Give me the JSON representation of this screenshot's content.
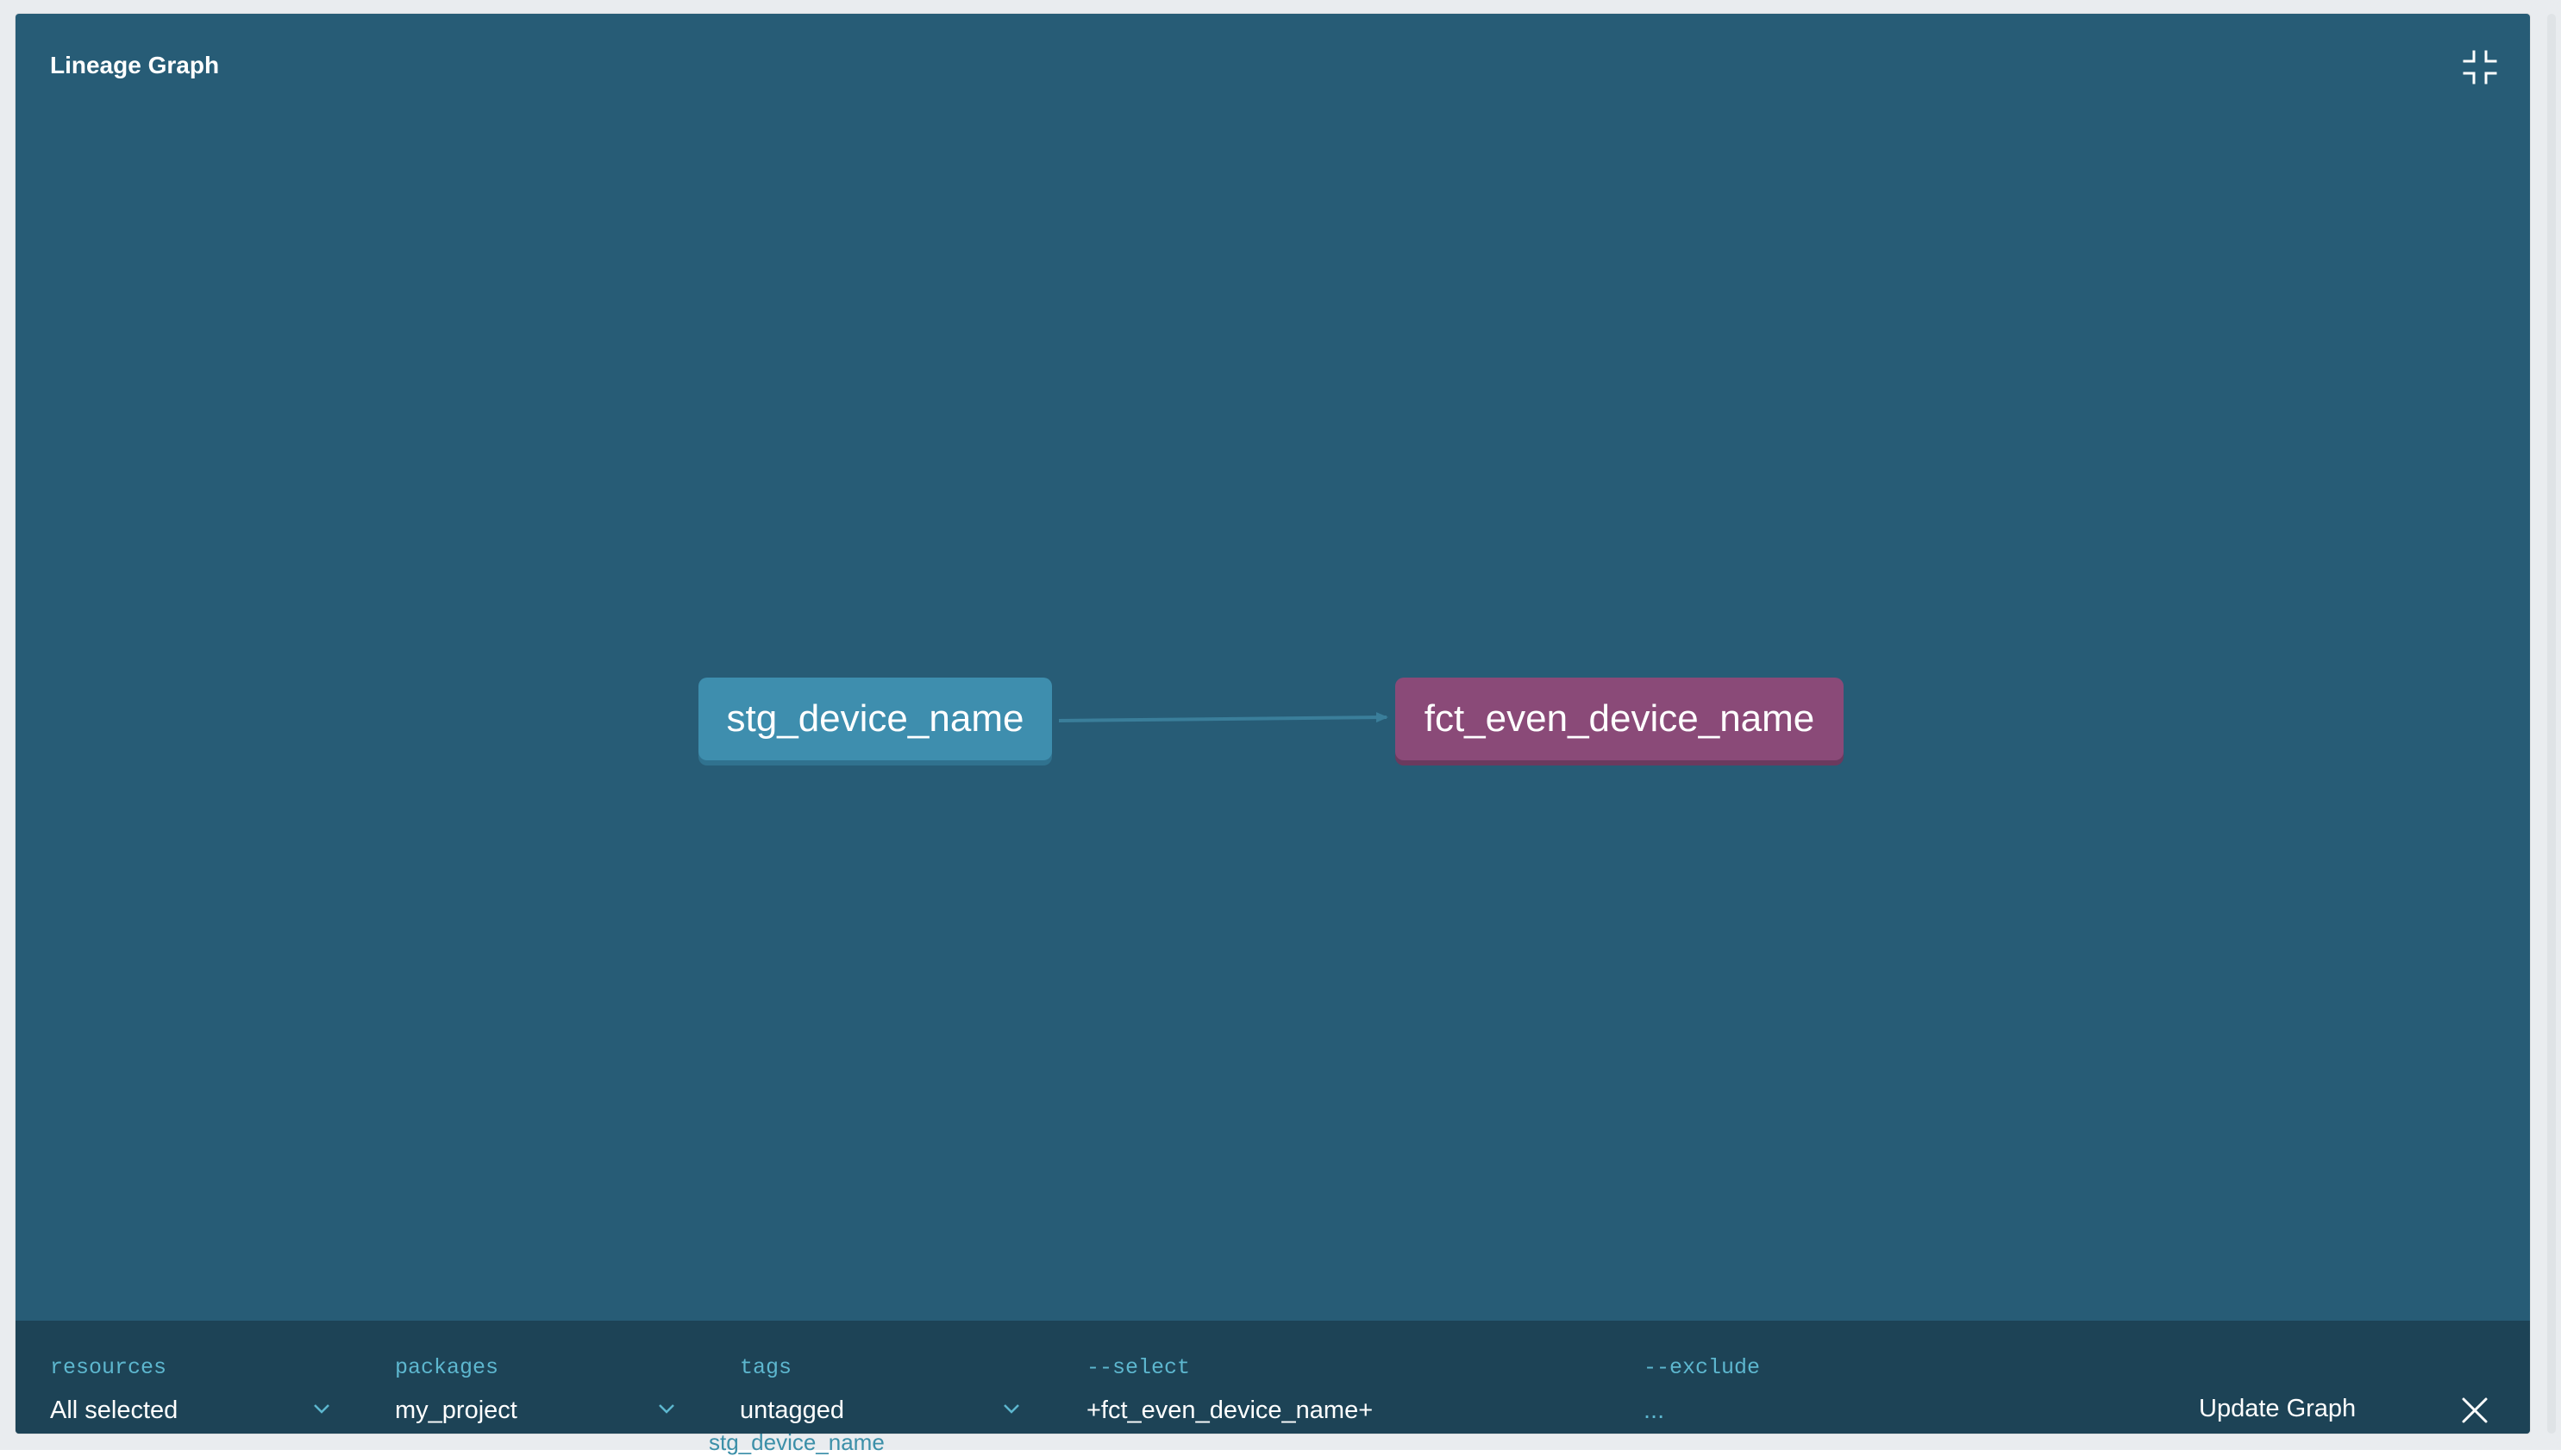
{
  "modal": {
    "title": "Lineage Graph",
    "collapse_icon": "collapse-fullscreen-icon"
  },
  "graph": {
    "nodes": [
      {
        "id": "source",
        "label": "stg_device_name",
        "color": "#3e8eae"
      },
      {
        "id": "target",
        "label": "fct_even_device_name",
        "color": "#8a4a78"
      }
    ],
    "edges": [
      {
        "from": "stg_device_name",
        "to": "fct_even_device_name"
      }
    ],
    "background": "#275c76"
  },
  "filters": {
    "resources": {
      "label": "resources",
      "value": "All selected"
    },
    "packages": {
      "label": "packages",
      "value": "my_project"
    },
    "tags": {
      "label": "tags",
      "value": "untagged"
    },
    "select": {
      "label": "--select",
      "value": "+fct_even_device_name+"
    },
    "exclude": {
      "label": "--exclude",
      "placeholder": "..."
    }
  },
  "actions": {
    "update_label": "Update Graph",
    "close_icon": "close-icon"
  },
  "underlying_page": {
    "partial_text": "stg_device_name"
  },
  "colors": {
    "modal_bg": "#275c76",
    "filter_bar_bg": "#1d4356",
    "label_accent": "#5db7cf"
  }
}
